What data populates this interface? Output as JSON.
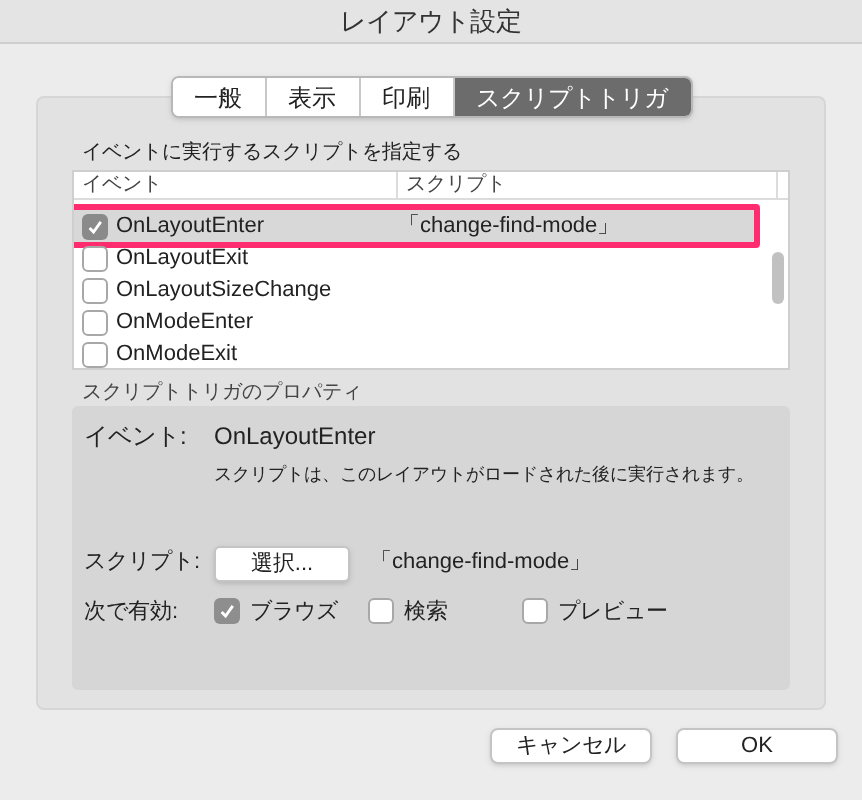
{
  "window": {
    "title": "レイアウト設定"
  },
  "tabs": [
    {
      "label": "一般",
      "selected": false
    },
    {
      "label": "表示",
      "selected": false
    },
    {
      "label": "印刷",
      "selected": false
    },
    {
      "label": "スクリプトトリガ",
      "selected": true
    }
  ],
  "list_label": "イベントに実行するスクリプトを指定する",
  "table": {
    "columns": [
      "イベント",
      "スクリプト"
    ],
    "rows": [
      {
        "event": "OnLayoutEnter",
        "script": "「change-find-mode」",
        "checked": true,
        "selected": true,
        "highlighted": true
      },
      {
        "event": "OnLayoutExit",
        "checked": false,
        "selected": false,
        "highlighted": false
      },
      {
        "event": "OnLayoutSizeChange",
        "checked": false,
        "selected": false,
        "highlighted": false
      },
      {
        "event": "OnModeEnter",
        "checked": false,
        "selected": false,
        "highlighted": false
      },
      {
        "event": "OnModeExit",
        "checked": false,
        "selected": false,
        "highlighted": false
      }
    ]
  },
  "properties": {
    "label": "スクリプトトリガのプロパティ",
    "event_label": "イベント:",
    "event_value": "OnLayoutEnter",
    "description": "スクリプトは、このレイアウトがロードされた後に実行されます。",
    "script_label": "スクリプト:",
    "select_button": "選択...",
    "script_value": "「change-find-mode」",
    "enabled_label": "次で有効:",
    "modes": [
      {
        "label": "ブラウズ",
        "checked": true
      },
      {
        "label": "検索",
        "checked": false
      },
      {
        "label": "プレビュー",
        "checked": false
      }
    ]
  },
  "buttons": [
    {
      "label": "キャンセル"
    },
    {
      "label": "OK"
    }
  ]
}
